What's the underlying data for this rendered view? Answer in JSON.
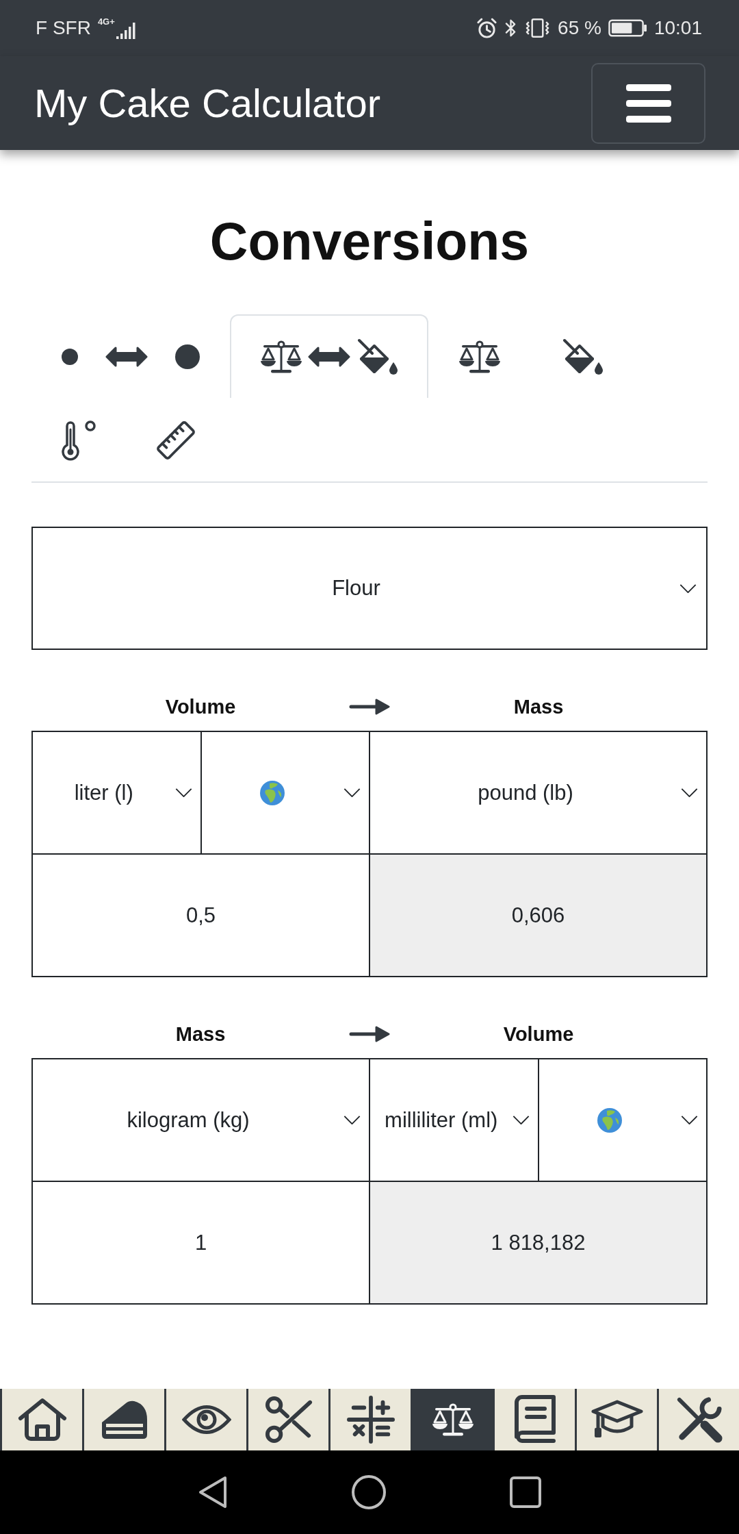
{
  "status_bar": {
    "carrier": "F SFR",
    "network": "4G+",
    "battery": "65 %",
    "time": "10:01"
  },
  "app_bar": {
    "title": "My Cake Calculator"
  },
  "heading": "Conversions",
  "tabs": [
    {
      "kind": "dots",
      "selected": false
    },
    {
      "kind": "scalebucket",
      "selected": true
    },
    {
      "kind": "scale",
      "selected": false
    },
    {
      "kind": "bucket",
      "selected": false
    },
    {
      "kind": "thermometer",
      "selected": false
    },
    {
      "kind": "ruler",
      "selected": false
    }
  ],
  "ingredient": {
    "value": "Flour"
  },
  "converters": [
    {
      "from": {
        "label": "Volume",
        "selects": [
          {
            "kind": "unit",
            "value": "liter (l)"
          },
          {
            "kind": "globe"
          }
        ],
        "amount": "0,5"
      },
      "to": {
        "label": "Mass",
        "selects": [
          {
            "kind": "unit",
            "value": "pound (lb)"
          }
        ],
        "result": "0,606"
      }
    },
    {
      "from": {
        "label": "Mass",
        "selects": [
          {
            "kind": "unit",
            "value": "kilogram (kg)"
          }
        ],
        "amount": "1"
      },
      "to": {
        "label": "Volume",
        "selects": [
          {
            "kind": "unit",
            "value": "milliliter (ml)"
          },
          {
            "kind": "globe"
          }
        ],
        "result": "1 818,182"
      }
    }
  ],
  "bottom_nav": [
    {
      "kind": "home",
      "selected": false
    },
    {
      "kind": "cake",
      "selected": false
    },
    {
      "kind": "eye",
      "selected": false
    },
    {
      "kind": "scissors",
      "selected": false
    },
    {
      "kind": "math",
      "selected": false
    },
    {
      "kind": "scale",
      "selected": true
    },
    {
      "kind": "book",
      "selected": false
    },
    {
      "kind": "graduation",
      "selected": false
    },
    {
      "kind": "tools",
      "selected": false
    }
  ]
}
